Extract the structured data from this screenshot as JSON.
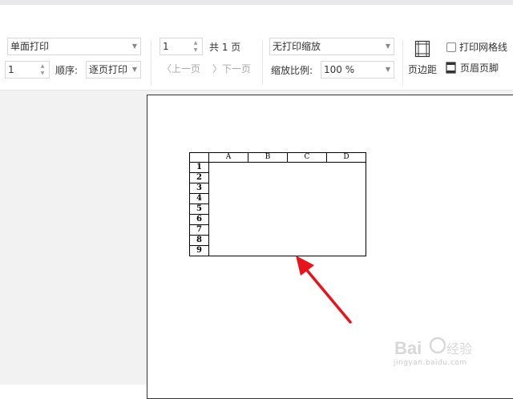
{
  "toolbar": {
    "print_mode": "单面打印",
    "copies": "1",
    "order_label": "顺序:",
    "order_value": "逐页打印",
    "page_current": "1",
    "page_total": "共 1 页",
    "prev_page": "上一页",
    "next_page": "下一页",
    "scaling_mode": "无打印缩放",
    "zoom_label": "缩放比例:",
    "zoom_value": "100 %",
    "margins_label": "页边距",
    "gridlines_label": "打印网格线",
    "header_footer_label": "页眉页脚"
  },
  "sheet": {
    "columns": [
      "A",
      "B",
      "C",
      "D"
    ],
    "rows": [
      "1",
      "2",
      "3",
      "4",
      "5",
      "6",
      "7",
      "8",
      "9"
    ]
  },
  "watermark": {
    "brand": "Baidu 经验",
    "url": "jingyan.baidu.com"
  },
  "colors": {
    "arrow": "#e8141c",
    "ribbon_bg": "#ffffff",
    "workspace_bg": "#f2f2f2"
  }
}
